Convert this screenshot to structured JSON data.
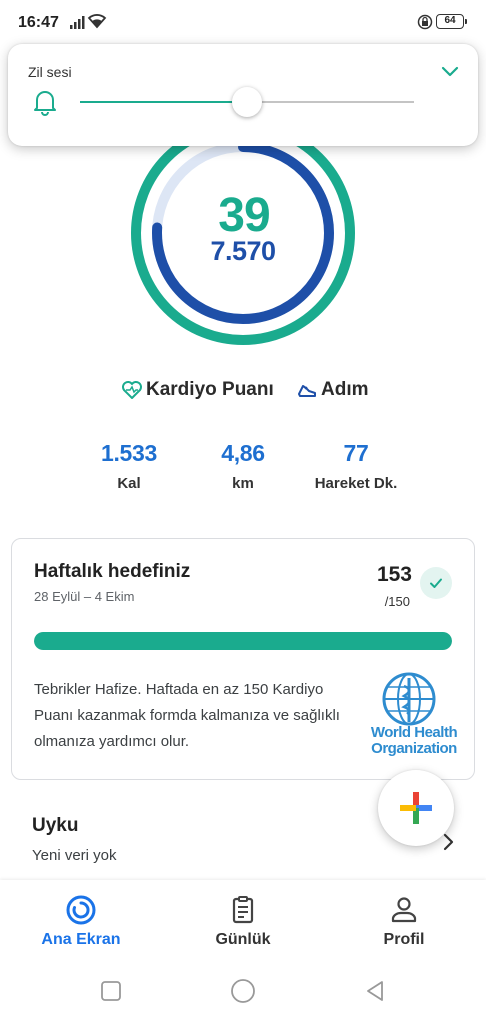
{
  "status_bar": {
    "time": "16:47",
    "battery": "64",
    "icons": [
      "signal-icon",
      "wifi-icon",
      "lock-rotation-icon",
      "battery-icon"
    ]
  },
  "volume_panel": {
    "label": "Zil sesi",
    "level_fraction": 0.5,
    "icons": [
      "bell-icon",
      "chevron-down-icon"
    ]
  },
  "ring": {
    "cardio_points": "39",
    "steps": "7.570",
    "cardio_fraction": 1.0,
    "steps_fraction": 0.76,
    "colors": {
      "outer": "#1aab8e",
      "inner": "#1e4fa8",
      "outer_track": "#dff3ee",
      "inner_track": "#dde6f5"
    }
  },
  "legend": {
    "cardio_label": "Kardiyo Puanı",
    "steps_label": "Adım"
  },
  "stats": [
    {
      "value": "1.533",
      "label": "Kal"
    },
    {
      "value": "4,86",
      "label": "km"
    },
    {
      "value": "77",
      "label": "Hareket Dk."
    }
  ],
  "weekly_goal": {
    "title": "Haftalık hedefiniz",
    "date_range": "28 Eylül – 4 Ekim",
    "value": "153",
    "target": "/150",
    "progress_fraction": 1.0,
    "message": "Tebrikler Hafize. Haftada en az 150 Kardiyo Puanı kazanmak formda kalmanıza ve sağlıklı olmanıza yardımcı olur.",
    "partner_line1": "World Health",
    "partner_line2": "Organization"
  },
  "sleep": {
    "title": "Uyku",
    "subtitle": "Yeni veri yok"
  },
  "bottom_nav": [
    {
      "label": "Ana Ekran",
      "icon": "home-ring-icon",
      "active": true
    },
    {
      "label": "Günlük",
      "icon": "journal-icon",
      "active": false
    },
    {
      "label": "Profil",
      "icon": "profile-icon",
      "active": false
    }
  ],
  "system_nav": [
    "recents-icon",
    "home-icon",
    "back-icon"
  ],
  "colors": {
    "accent_green": "#1aab8e",
    "accent_blue": "#1e4fa8",
    "stat_blue": "#1e6fd0",
    "nav_active": "#1a73e8"
  }
}
